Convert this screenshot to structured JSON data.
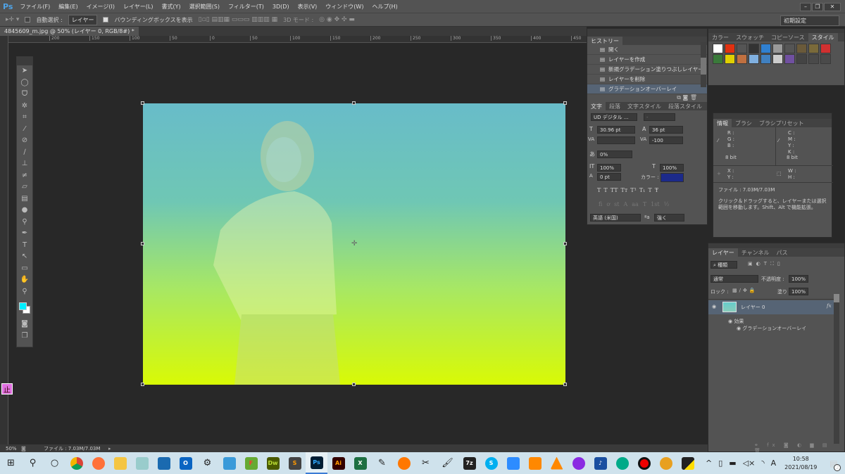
{
  "app": {
    "logo": "Ps",
    "menu": [
      "ファイル(F)",
      "編集(E)",
      "イメージ(I)",
      "レイヤー(L)",
      "書式(Y)",
      "選択範囲(S)",
      "フィルター(T)",
      "3D(D)",
      "表示(V)",
      "ウィンドウ(W)",
      "ヘルプ(H)"
    ],
    "window_buttons": [
      "–",
      "❐",
      "✕"
    ]
  },
  "options": {
    "auto_select_label": "自動選択 :",
    "auto_select_value": "レイヤー",
    "bounding_box_label": "バウンディングボックスを表示",
    "mode3d_label": "3D モード :",
    "workspace": "初期設定"
  },
  "document": {
    "tab_title": "4845609_m.jpg @ 50% (レイヤー 0, RGB/8#) *",
    "ruler_ticks": [
      "200",
      "150",
      "100",
      "50",
      "0",
      "50",
      "100",
      "150",
      "200",
      "250",
      "300",
      "350",
      "400",
      "450",
      "500",
      "550",
      "600",
      "650",
      "700"
    ]
  },
  "toolbar": {
    "foreground": "#00f0ff",
    "background": "#ffffff"
  },
  "history": {
    "title": "ヒストリー",
    "items": [
      "開く",
      "レイヤーを作成",
      "新規グラデーション塗りつぶしレイヤー",
      "レイヤーを削除",
      "グラデーションオーバーレイ"
    ],
    "selected": 4
  },
  "character": {
    "tabs": [
      "文字",
      "段落",
      "文字スタイル",
      "段落スタイル"
    ],
    "font": "UD デジタル ...",
    "style": "-",
    "size": "30.96 pt",
    "leading": "36 pt",
    "kerning": "",
    "tracking": "-100",
    "tsume": "0%",
    "vscale": "100%",
    "hscale": "100%",
    "baseline": "0 pt",
    "color_label": "カラー :",
    "color": "#1c2a8a",
    "language": "英語 (米国)",
    "aa": "強く",
    "style_buttons": [
      "T",
      "T",
      "TT",
      "Tт",
      "T¹",
      "T₁",
      "T",
      "Ŧ"
    ],
    "ot_buttons": [
      "fi",
      "ơ",
      "st",
      "A",
      "aa",
      "T",
      "1st",
      "½"
    ]
  },
  "styles_panel": {
    "tabs": [
      "カラー",
      "スウォッチ",
      "コピーソース",
      "スタイル"
    ],
    "swatches": [
      "#ffffff",
      "#e03010",
      "#555",
      "#333",
      "#3080d0",
      "#999",
      "#555",
      "#6a5a3a",
      "#7a6a3a",
      "#d03030",
      "#3a7a3a",
      "#e0d000",
      "#c07040",
      "#80b0e0",
      "#4080c0",
      "#ccc",
      "#7050a0",
      "#444",
      "#4a4a4a",
      "#4a4a4a"
    ]
  },
  "info": {
    "tabs": [
      "情報",
      "ブラシ",
      "ブラシプリセット"
    ],
    "rgb": [
      "R :",
      "G :",
      "B :"
    ],
    "cmyk": [
      "C :",
      "M :",
      "Y :",
      "K :"
    ],
    "bit_left": "8 bit",
    "bit_right": "8 bit",
    "xy": [
      "X :",
      "Y :"
    ],
    "wh": [
      "W :",
      "H :"
    ],
    "file": "ファイル : 7.03M/7.03M",
    "hint": "クリック＆ドラッグすると、レイヤーまたは選択範囲を移動します。Shift、Alt で機能拡張。"
  },
  "layers": {
    "tabs": [
      "レイヤー",
      "チャンネル",
      "パス"
    ],
    "filter": "種類",
    "blend": "通常",
    "opacity_label": "不透明度 :",
    "opacity": "100%",
    "lock_label": "ロック :",
    "fill_label": "塗り :",
    "fill": "100%",
    "layer_name": "レイヤー 0",
    "effects_label": "効果",
    "effect": "グラデーションオーバーレイ",
    "fx": "fx"
  },
  "status": {
    "zoom": "50%",
    "file": "ファイル : 7.03M/7.03M"
  },
  "taskbar": {
    "apps": [
      "Dw",
      "Ps",
      "Ai",
      "X",
      "7z",
      "S"
    ],
    "time": "10:58",
    "date": "2021/08/19",
    "notifications": "2",
    "ime": "A"
  }
}
